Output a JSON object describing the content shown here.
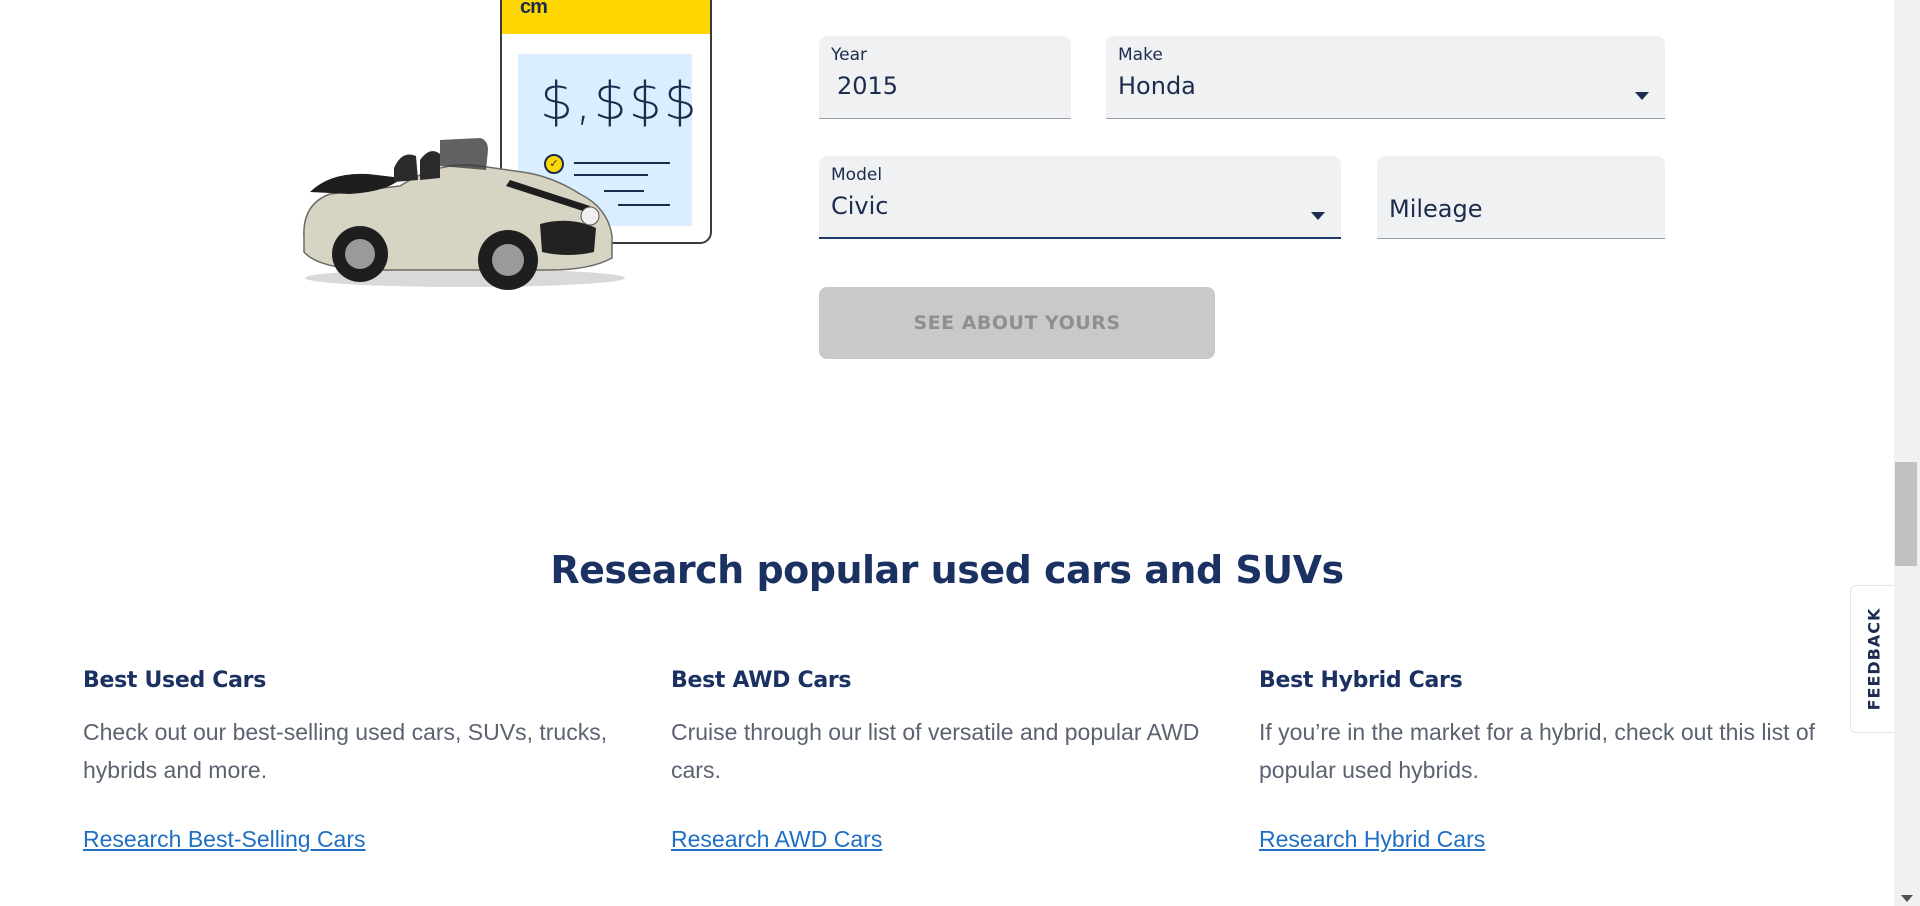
{
  "illustration": {
    "logo_text": "cm",
    "price_text": "$,$$$",
    "check_icon": "check-circle-icon",
    "car_icon": "convertible-car-illustration"
  },
  "form": {
    "year": {
      "label": "Year",
      "value": "2015"
    },
    "make": {
      "label": "Make",
      "value": "Honda",
      "icon": "chevron-down-icon"
    },
    "model": {
      "label": "Model",
      "value": "Civic",
      "icon": "chevron-down-icon"
    },
    "mileage": {
      "placeholder": "Mileage"
    },
    "submit_label": "SEE ABOUT YOURS"
  },
  "research": {
    "title": "Research popular used cars and SUVs",
    "cards": [
      {
        "heading": "Best Used Cars",
        "body": "Check out our best-selling used cars, SUVs, trucks, hybrids and more.",
        "link": "Research Best-Selling Cars"
      },
      {
        "heading": "Best AWD Cars",
        "body": "Cruise through our list of versatile and popular AWD cars.",
        "link": "Research AWD Cars"
      },
      {
        "heading": "Best Hybrid Cars",
        "body": "If you’re in the market for a hybrid, check out this list of popular used hybrids.",
        "link": "Research Hybrid Cars"
      }
    ]
  },
  "feedback_label": "FEEDBACK",
  "colors": {
    "brand_navy": "#1b3162",
    "brand_yellow": "#ffd700",
    "link_blue": "#1f6fc4",
    "field_bg": "#f0f1f3",
    "button_disabled": "#c8c9cb"
  }
}
